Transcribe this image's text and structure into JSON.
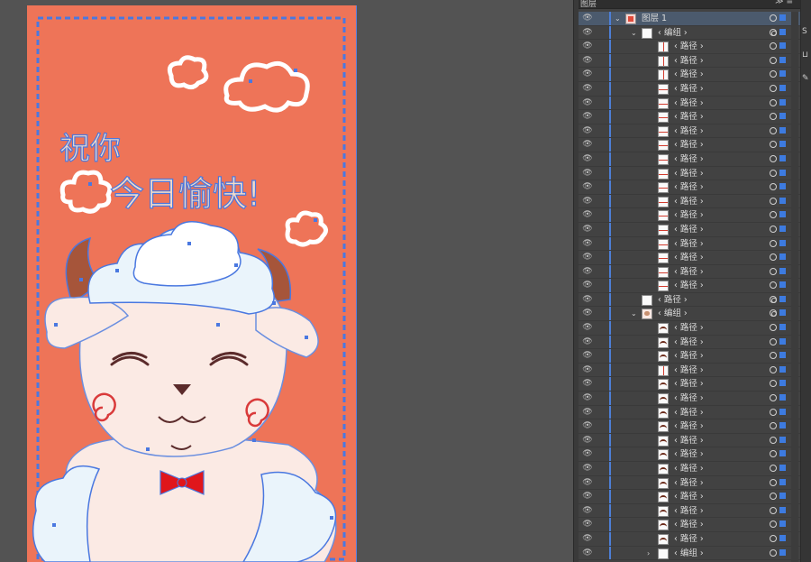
{
  "panel": {
    "tab_title": "图层",
    "menu_glyph": "≫ ≡"
  },
  "rows": [
    {
      "kind": "layer",
      "label": "图层 1",
      "indent": 0,
      "chevron": "⌄",
      "thumb": "red",
      "selected": true,
      "target": "single"
    },
    {
      "kind": "group",
      "label": "‹ 编组 ›",
      "indent": 1,
      "chevron": "⌄",
      "thumb": "plain",
      "target": "double"
    },
    {
      "kind": "path",
      "label": "‹ 路径 ›",
      "indent": 2,
      "thumb": "line-v"
    },
    {
      "kind": "path",
      "label": "‹ 路径 ›",
      "indent": 2,
      "thumb": "line-v"
    },
    {
      "kind": "path",
      "label": "‹ 路径 ›",
      "indent": 2,
      "thumb": "line-v"
    },
    {
      "kind": "path",
      "label": "‹ 路径 ›",
      "indent": 2,
      "thumb": "line-h"
    },
    {
      "kind": "path",
      "label": "‹ 路径 ›",
      "indent": 2,
      "thumb": "line-h"
    },
    {
      "kind": "path",
      "label": "‹ 路径 ›",
      "indent": 2,
      "thumb": "line-h"
    },
    {
      "kind": "path",
      "label": "‹ 路径 ›",
      "indent": 2,
      "thumb": "line-h"
    },
    {
      "kind": "path",
      "label": "‹ 路径 ›",
      "indent": 2,
      "thumb": "line-h"
    },
    {
      "kind": "path",
      "label": "‹ 路径 ›",
      "indent": 2,
      "thumb": "line-h"
    },
    {
      "kind": "path",
      "label": "‹ 路径 ›",
      "indent": 2,
      "thumb": "line-h"
    },
    {
      "kind": "path",
      "label": "‹ 路径 ›",
      "indent": 2,
      "thumb": "line-h"
    },
    {
      "kind": "path",
      "label": "‹ 路径 ›",
      "indent": 2,
      "thumb": "line-h"
    },
    {
      "kind": "path",
      "label": "‹ 路径 ›",
      "indent": 2,
      "thumb": "line-h"
    },
    {
      "kind": "path",
      "label": "‹ 路径 ›",
      "indent": 2,
      "thumb": "line-h"
    },
    {
      "kind": "path",
      "label": "‹ 路径 ›",
      "indent": 2,
      "thumb": "line-h"
    },
    {
      "kind": "path",
      "label": "‹ 路径 ›",
      "indent": 2,
      "thumb": "line-h"
    },
    {
      "kind": "path",
      "label": "‹ 路径 ›",
      "indent": 2,
      "thumb": "line-h"
    },
    {
      "kind": "path",
      "label": "‹ 路径 ›",
      "indent": 2,
      "thumb": "line-h"
    },
    {
      "kind": "path",
      "label": "‹ 路径 ›",
      "indent": 1,
      "thumb": "plain",
      "target": "double"
    },
    {
      "kind": "group",
      "label": "‹ 编组 ›",
      "indent": 1,
      "chevron": "⌄",
      "thumb": "sheep",
      "target": "double"
    },
    {
      "kind": "path",
      "label": "‹ 路径 ›",
      "indent": 2,
      "thumb": "arc"
    },
    {
      "kind": "path",
      "label": "‹ 路径 ›",
      "indent": 2,
      "thumb": "arc"
    },
    {
      "kind": "path",
      "label": "‹ 路径 ›",
      "indent": 2,
      "thumb": "arc"
    },
    {
      "kind": "path",
      "label": "‹ 路径 ›",
      "indent": 2,
      "thumb": "line-v"
    },
    {
      "kind": "path",
      "label": "‹ 路径 ›",
      "indent": 2,
      "thumb": "arc"
    },
    {
      "kind": "path",
      "label": "‹ 路径 ›",
      "indent": 2,
      "thumb": "arc"
    },
    {
      "kind": "path",
      "label": "‹ 路径 ›",
      "indent": 2,
      "thumb": "arc"
    },
    {
      "kind": "path",
      "label": "‹ 路径 ›",
      "indent": 2,
      "thumb": "arc"
    },
    {
      "kind": "path",
      "label": "‹ 路径 ›",
      "indent": 2,
      "thumb": "arc"
    },
    {
      "kind": "path",
      "label": "‹ 路径 ›",
      "indent": 2,
      "thumb": "arc"
    },
    {
      "kind": "path",
      "label": "‹ 路径 ›",
      "indent": 2,
      "thumb": "arc"
    },
    {
      "kind": "path",
      "label": "‹ 路径 ›",
      "indent": 2,
      "thumb": "arc"
    },
    {
      "kind": "path",
      "label": "‹ 路径 ›",
      "indent": 2,
      "thumb": "arc"
    },
    {
      "kind": "path",
      "label": "‹ 路径 ›",
      "indent": 2,
      "thumb": "arc"
    },
    {
      "kind": "path",
      "label": "‹ 路径 ›",
      "indent": 2,
      "thumb": "arc"
    },
    {
      "kind": "path",
      "label": "‹ 路径 ›",
      "indent": 2,
      "thumb": "arc"
    },
    {
      "kind": "group",
      "label": "‹ 编组 ›",
      "indent": 2,
      "chevron": "›",
      "thumb": "plain"
    }
  ],
  "artwork": {
    "greeting_line1": "祝你",
    "greeting_line2": "今日愉快!",
    "background_color": "#ee7458",
    "selection_color": "#4a78e0"
  },
  "strip_icons": [
    "S",
    "⊔",
    "✎"
  ]
}
